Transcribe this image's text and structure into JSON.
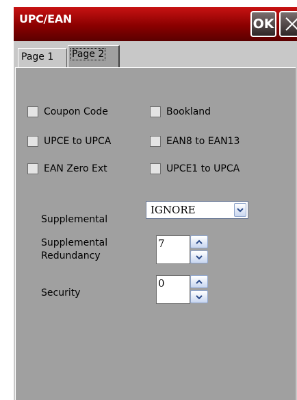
{
  "window": {
    "title": "UPC/EAN",
    "ok_label": "OK",
    "close_icon": "close-icon",
    "title_bar_color": "#b00000"
  },
  "tabs": [
    {
      "label": "Page 1",
      "selected": false
    },
    {
      "label": "Page 2",
      "selected": true
    }
  ],
  "checkboxes": {
    "coupon_code": {
      "label": "Coupon Code",
      "checked": false
    },
    "bookland": {
      "label": "Bookland",
      "checked": false
    },
    "upce_to_upca": {
      "label": "UPCE to UPCA",
      "checked": false
    },
    "ean8_to_ean13": {
      "label": "EAN8 to EAN13",
      "checked": false
    },
    "ean_zero_ext": {
      "label": "EAN Zero Ext",
      "checked": false
    },
    "upce1_to_upca": {
      "label": "UPCE1 to UPCA",
      "checked": false
    }
  },
  "supplemental": {
    "label": "Supplemental",
    "selected": "IGNORE"
  },
  "supplemental_redundancy": {
    "label_line1": "Supplemental",
    "label_line2": "Redundancy",
    "value": "7"
  },
  "security": {
    "label": "Security",
    "value": "0"
  }
}
